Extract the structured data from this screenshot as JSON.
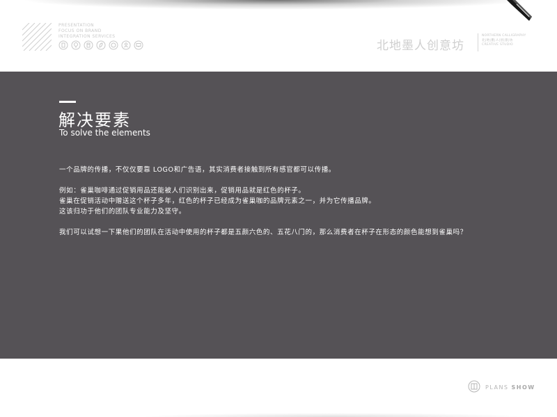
{
  "header": {
    "tagline": [
      "PRESENTATION",
      "FOCUS ON BRAND",
      "INTEGRATION SERVICES"
    ],
    "icons": [
      "badge-icon",
      "bulb-icon",
      "document-icon",
      "leaf-icon",
      "globe-icon",
      "person-icon",
      "monitor-icon"
    ],
    "brand_cn": "北地墨人创意坊",
    "brand_en": [
      "NORTHERN CALLIGRAPHY",
      "北|地|墨|人|创|意|坊",
      "CREATIVE STUDIO"
    ]
  },
  "section": {
    "title_cn": "解决要素",
    "title_en": "To solve the elements"
  },
  "body": {
    "p1": "一个品牌的传播，不仅仅要靠 LOGO和广告语，其实消费者接触到所有感官都可以传播。",
    "p2_lines": [
      "例如：雀巢咖啡通过促销用品还能被人们识别出来，促销用品就是红色的杯子。",
      "雀巢在促销活动中赠送这个杯子多年，红色的杯子已经成为雀巢咖的品牌元素之一，并为它传播品牌。",
      "这该归功于他们的团队专业能力及坚守。"
    ],
    "p3": "我们可以试想一下果他们的团队在活动中使用的杯子都是五颜六色的、五花八门的，那么消费者在杯子在形态的颜色能想到雀巢吗？"
  },
  "footer": {
    "plans": "PLANS",
    "show": "SHOW"
  },
  "colors": {
    "panel": "#555256",
    "text": "#ffffff",
    "muted": "#cfcfcf"
  }
}
